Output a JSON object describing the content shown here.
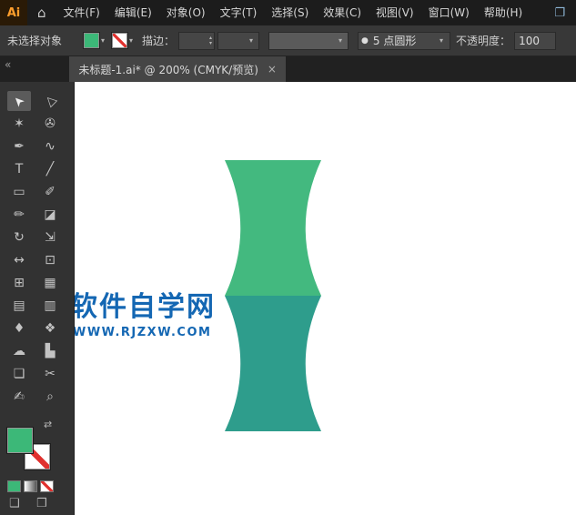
{
  "menu_bar": {
    "logo": "Ai",
    "home_icon": "⌂",
    "items": [
      "文件(F)",
      "编辑(E)",
      "对象(O)",
      "文字(T)",
      "选择(S)",
      "效果(C)",
      "视图(V)",
      "窗口(W)",
      "帮助(H)"
    ],
    "workspace_icon": "❐"
  },
  "control_bar": {
    "selection_status": "未选择对象",
    "stroke_label": "描边：",
    "stroke_weight_value": "",
    "brush_bullet": "●",
    "brush_name": "5 点圆形",
    "opacity_label": "不透明度：",
    "opacity_value": "100"
  },
  "tab_bar": {
    "collapse_icon": "«",
    "tab_title": "未标题-1.ai* @ 200% (CMYK/预览)",
    "close_icon": "×"
  },
  "icons": {
    "chevron_down": "▾",
    "stepper_up": "▴",
    "stepper_down": "▾",
    "swap": "⇄"
  },
  "toolbar": {
    "fill_color": "#3CB878",
    "tools": [
      {
        "name": "selection-tool",
        "glyph": "➤",
        "selected": true
      },
      {
        "name": "direct-selection-tool",
        "glyph": "▷"
      },
      {
        "name": "magic-wand-tool",
        "glyph": "✶"
      },
      {
        "name": "lasso-tool",
        "glyph": "✇"
      },
      {
        "name": "pen-tool",
        "glyph": "✒"
      },
      {
        "name": "curvature-tool",
        "glyph": "∿"
      },
      {
        "name": "type-tool",
        "glyph": "T"
      },
      {
        "name": "line-segment-tool",
        "glyph": "╱"
      },
      {
        "name": "rectangle-tool",
        "glyph": "▭"
      },
      {
        "name": "paintbrush-tool",
        "glyph": "✐"
      },
      {
        "name": "shaper-tool",
        "glyph": "✏"
      },
      {
        "name": "eraser-tool",
        "glyph": "◪"
      },
      {
        "name": "rotate-tool",
        "glyph": "↻"
      },
      {
        "name": "scale-tool",
        "glyph": "⇲"
      },
      {
        "name": "width-tool",
        "glyph": "↔"
      },
      {
        "name": "free-transform-tool",
        "glyph": "⊡"
      },
      {
        "name": "shape-builder-tool",
        "glyph": "⊞"
      },
      {
        "name": "perspective-grid-tool",
        "glyph": "▦"
      },
      {
        "name": "mesh-tool",
        "glyph": "▤"
      },
      {
        "name": "gradient-tool",
        "glyph": "▥"
      },
      {
        "name": "eyedropper-tool",
        "glyph": "♦"
      },
      {
        "name": "blend-tool",
        "glyph": "❖"
      },
      {
        "name": "symbol-sprayer-tool",
        "glyph": "☁"
      },
      {
        "name": "column-graph-tool",
        "glyph": "▙"
      },
      {
        "name": "artboard-tool",
        "glyph": "❏"
      },
      {
        "name": "slice-tool",
        "glyph": "✂"
      },
      {
        "name": "hand-tool",
        "glyph": "✍"
      },
      {
        "name": "zoom-tool",
        "glyph": "⌕"
      }
    ],
    "mode_icons": [
      "❑",
      "❒"
    ]
  },
  "canvas": {
    "watermark_title": "软件自学网",
    "watermark_url": "WWW.RJZXW.COM",
    "watermark_color": "#1467B3",
    "shape": {
      "top_color": "#43B97F",
      "bottom_color": "#2E9D8C"
    }
  }
}
